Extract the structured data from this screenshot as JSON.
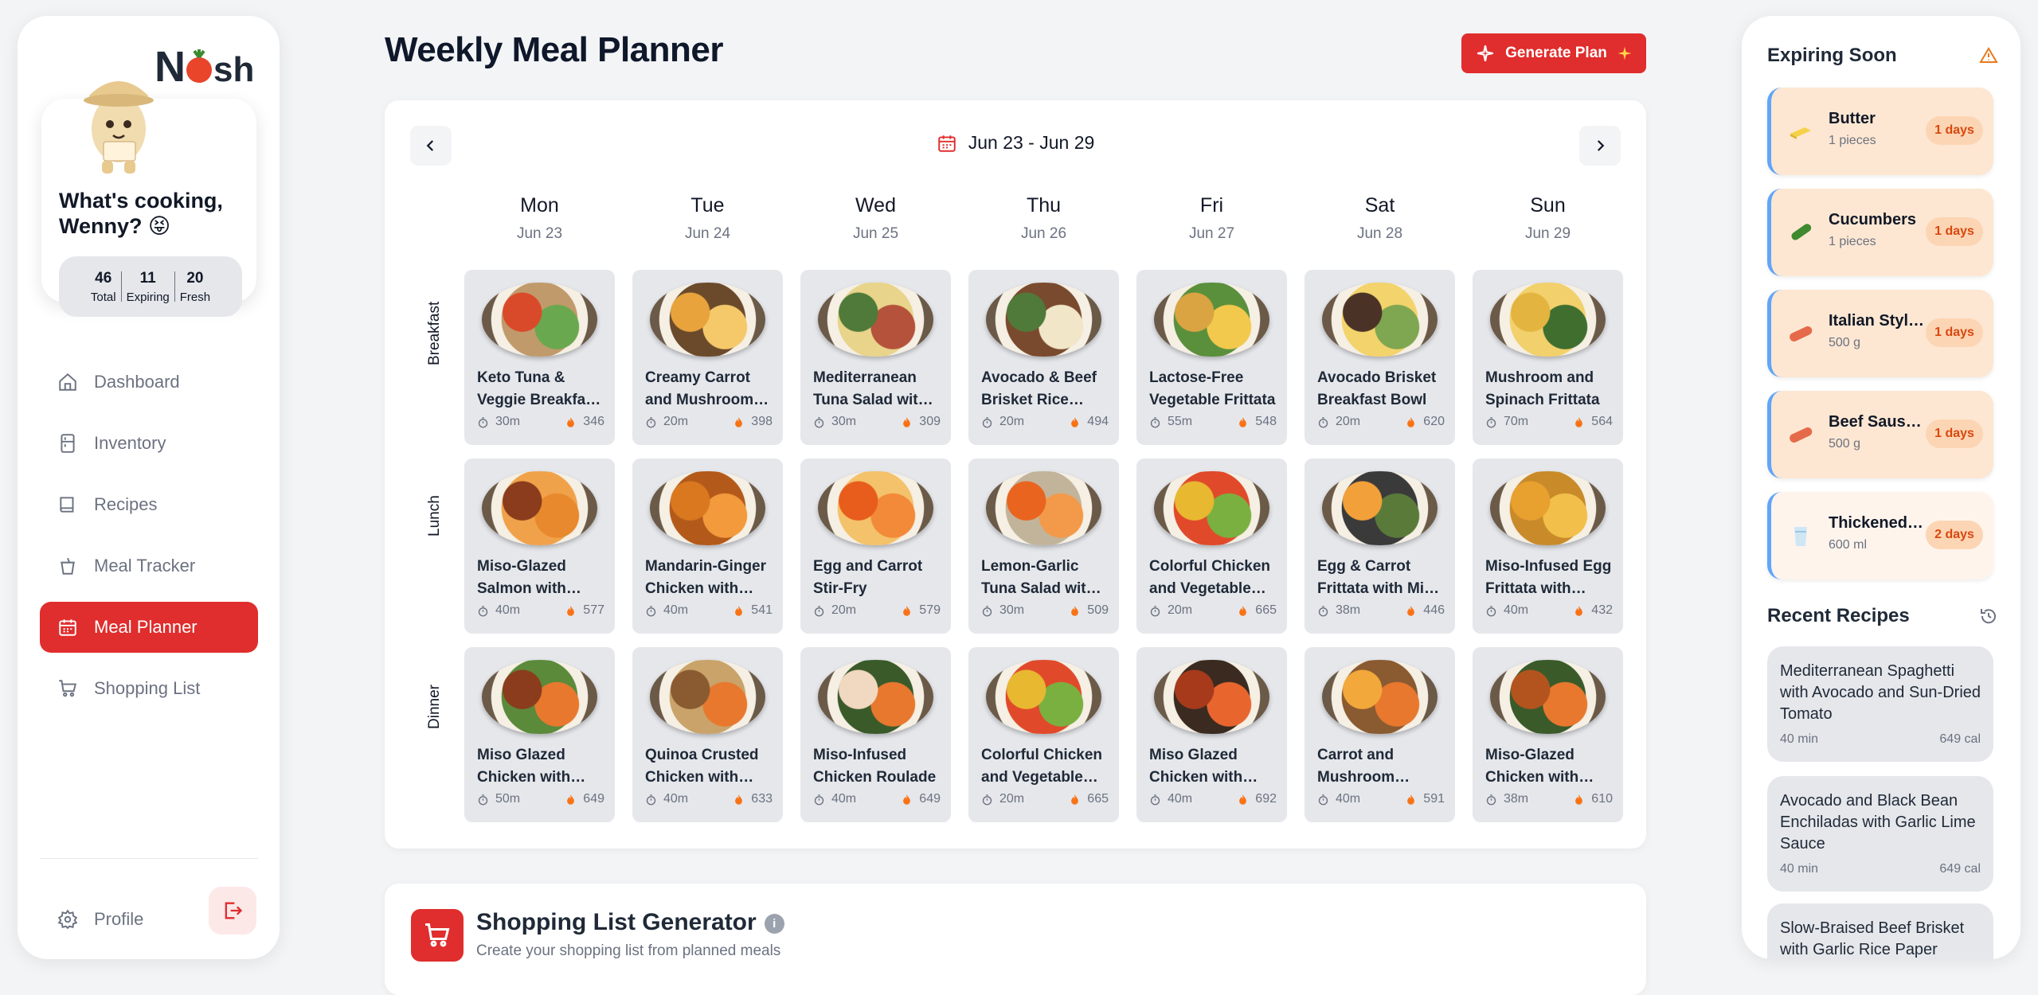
{
  "app": {
    "logo_text": "Nosh"
  },
  "user": {
    "greeting": "What's cooking, Wenny? 😝"
  },
  "stats": [
    {
      "value": "46",
      "label": "Total"
    },
    {
      "value": "11",
      "label": "Expiring"
    },
    {
      "value": "20",
      "label": "Fresh"
    }
  ],
  "nav": [
    {
      "label": "Dashboard",
      "icon": "home-icon"
    },
    {
      "label": "Inventory",
      "icon": "inventory-icon"
    },
    {
      "label": "Recipes",
      "icon": "book-icon"
    },
    {
      "label": "Meal Tracker",
      "icon": "cup-icon"
    },
    {
      "label": "Meal Planner",
      "icon": "calendar-icon",
      "active": true
    },
    {
      "label": "Shopping List",
      "icon": "cart-icon"
    }
  ],
  "profile": {
    "label": "Profile"
  },
  "header": {
    "title": "Weekly Meal Planner",
    "generate_label": "Generate Plan"
  },
  "planner": {
    "range": "Jun 23 - Jun 29",
    "days": [
      {
        "day": "Mon",
        "date": "Jun 23"
      },
      {
        "day": "Tue",
        "date": "Jun 24"
      },
      {
        "day": "Wed",
        "date": "Jun 25"
      },
      {
        "day": "Thu",
        "date": "Jun 26"
      },
      {
        "day": "Fri",
        "date": "Jun 27"
      },
      {
        "day": "Sat",
        "date": "Jun 28"
      },
      {
        "day": "Sun",
        "date": "Jun 29"
      }
    ],
    "meal_types": [
      "Breakfast",
      "Lunch",
      "Dinner"
    ],
    "meals": [
      [
        {
          "name": "Keto Tuna & Veggie Breakfast Bowl",
          "time": "30m",
          "cal": "346",
          "colors": [
            "#d94a2a",
            "#6aa84f",
            "#c19a6b"
          ]
        },
        {
          "name": "Creamy Carrot and Mushroom Frittata",
          "time": "20m",
          "cal": "398",
          "colors": [
            "#e8a33d",
            "#f5c96a",
            "#6b4a2b"
          ]
        },
        {
          "name": "Mediterranean Tuna Salad with Avocado",
          "time": "30m",
          "cal": "309",
          "colors": [
            "#4f7a3a",
            "#b5523b",
            "#e8d48a"
          ]
        },
        {
          "name": "Avocado & Beef Brisket Rice Bowl",
          "time": "20m",
          "cal": "494",
          "colors": [
            "#4f7a3a",
            "#f1e6c8",
            "#7a4a2e"
          ]
        },
        {
          "name": "Lactose-Free Vegetable Frittata",
          "time": "55m",
          "cal": "548",
          "colors": [
            "#d9a441",
            "#f2c94c",
            "#5a8f3c"
          ]
        },
        {
          "name": "Avocado Brisket Breakfast Bowl",
          "time": "20m",
          "cal": "620",
          "colors": [
            "#4a3326",
            "#7fa650",
            "#f3d36b"
          ]
        },
        {
          "name": "Mushroom and Spinach Frittata",
          "time": "70m",
          "cal": "564",
          "colors": [
            "#e3b43f",
            "#3f6e2f",
            "#f2d06b"
          ]
        }
      ],
      [
        {
          "name": "Miso-Glazed Salmon with Carrot Puree",
          "time": "40m",
          "cal": "577",
          "colors": [
            "#8a3c1c",
            "#e8892e",
            "#f0a24a"
          ]
        },
        {
          "name": "Mandarin-Ginger Chicken with Carrots",
          "time": "40m",
          "cal": "541",
          "colors": [
            "#d9781e",
            "#f29a3c",
            "#b35a1a"
          ]
        },
        {
          "name": "Egg and Carrot Stir-Fry",
          "time": "20m",
          "cal": "579",
          "colors": [
            "#e85d1c",
            "#f28a3a",
            "#f3c26a"
          ]
        },
        {
          "name": "Lemon-Garlic Tuna Salad with Carrots",
          "time": "30m",
          "cal": "509",
          "colors": [
            "#e8641f",
            "#f29a4a",
            "#c2b49a"
          ]
        },
        {
          "name": "Colorful Chicken and Vegetable Stir-Fry",
          "time": "20m",
          "cal": "665",
          "colors": [
            "#e8b830",
            "#7ab040",
            "#e04a2a"
          ]
        },
        {
          "name": "Egg & Carrot Frittata with Miso Sauce",
          "time": "38m",
          "cal": "446",
          "colors": [
            "#f2a03a",
            "#5a7a3a",
            "#3a3a3a"
          ]
        },
        {
          "name": "Miso-Infused Egg Frittata with Carrots",
          "time": "40m",
          "cal": "432",
          "colors": [
            "#e8a02e",
            "#f2c04a",
            "#c98a2a"
          ]
        }
      ],
      [
        {
          "name": "Miso Glazed Chicken with Carrots",
          "time": "50m",
          "cal": "649",
          "colors": [
            "#8a3c1c",
            "#e8782e",
            "#5a8a3a"
          ]
        },
        {
          "name": "Quinoa Crusted Chicken with Carrots",
          "time": "40m",
          "cal": "633",
          "colors": [
            "#8a5a30",
            "#e8782e",
            "#c9a36a"
          ]
        },
        {
          "name": "Miso-Infused Chicken Roulade",
          "time": "40m",
          "cal": "649",
          "colors": [
            "#f1d8c0",
            "#e8782e",
            "#3a5a2a"
          ]
        },
        {
          "name": "Colorful Chicken and Vegetable Stir-Fry",
          "time": "20m",
          "cal": "665",
          "colors": [
            "#e8b830",
            "#7ab040",
            "#e04a2a"
          ]
        },
        {
          "name": "Miso Glazed Chicken with Carrots",
          "time": "40m",
          "cal": "692",
          "colors": [
            "#a83a1c",
            "#e8662e",
            "#3a2a20"
          ]
        },
        {
          "name": "Carrot and Mushroom Frittata",
          "time": "40m",
          "cal": "591",
          "colors": [
            "#f2a83a",
            "#e8782e",
            "#8a5a30"
          ]
        },
        {
          "name": "Miso-Glazed Chicken with Carrots",
          "time": "38m",
          "cal": "610",
          "colors": [
            "#b3541e",
            "#e8782e",
            "#3a5a2a"
          ]
        }
      ]
    ]
  },
  "shopping": {
    "title": "Shopping List Generator",
    "subtitle": "Create your shopping list from planned meals",
    "info": "i"
  },
  "expiring": {
    "title": "Expiring Soon",
    "items": [
      {
        "name": "Butter",
        "qty": "1 pieces",
        "badge": "1 days",
        "bg": "#fde7d2",
        "icon": "butter-icon"
      },
      {
        "name": "Cucumbers",
        "qty": "1 pieces",
        "badge": "1 days",
        "bg": "#fde7d2",
        "icon": "cucumber-icon"
      },
      {
        "name": "Italian Style Sausage",
        "qty": "500 g",
        "badge": "1 days",
        "bg": "#fde7d2",
        "icon": "sausage-icon"
      },
      {
        "name": "Beef Sausages",
        "qty": "500 g",
        "badge": "1 days",
        "bg": "#fde7d2",
        "icon": "sausage-icon"
      },
      {
        "name": "Thickened Cream",
        "qty": "600 ml",
        "badge": "2 days",
        "bg": "#fef4ec",
        "icon": "cream-icon"
      }
    ]
  },
  "recent": {
    "title": "Recent Recipes",
    "items": [
      {
        "title": "Mediterranean Spaghetti with Avocado and Sun-Dried Tomato",
        "time": "40 min",
        "cal": "649 cal"
      },
      {
        "title": "Avocado and Black Bean Enchiladas with Garlic Lime Sauce",
        "time": "40 min",
        "cal": "649 cal"
      },
      {
        "title": "Slow-Braised Beef Brisket with Garlic Rice Paper",
        "time": "",
        "cal": ""
      }
    ]
  }
}
